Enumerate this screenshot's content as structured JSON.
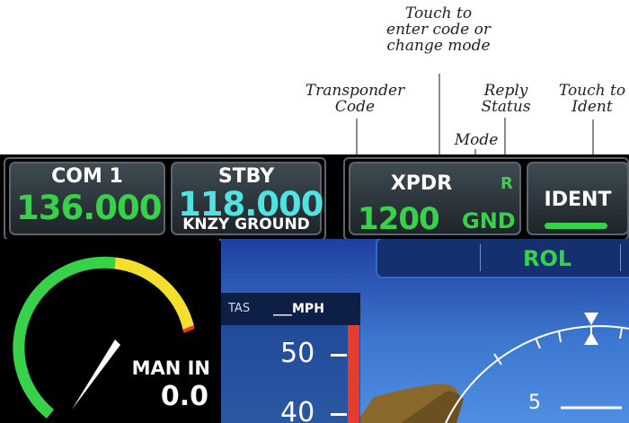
{
  "callouts": {
    "touch_code": "Touch to\nenter code or\nchange mode",
    "transponder_code": "Transponder\nCode",
    "reply_status": "Reply\nStatus",
    "touch_ident": "Touch to\nIdent",
    "mode": "Mode"
  },
  "com": {
    "title": "COM 1",
    "active_freq": "136.000",
    "standby_title": "STBY",
    "standby_freq": "118.000",
    "standby_station": "KNZY GROUND"
  },
  "xpdr": {
    "title": "XPDR",
    "reply": "R",
    "code": "1200",
    "mode": "GND"
  },
  "ident": {
    "label": "IDENT"
  },
  "gauge": {
    "label": "MAN IN",
    "value": "0.0"
  },
  "pfd": {
    "mode_annunciation": "ROL",
    "tas_label": "TAS",
    "tas_value": "___MPH",
    "speed_tape": [
      "50",
      "40"
    ],
    "pitch_mark": "5"
  },
  "colors": {
    "green": "#38d24a",
    "cyan": "#4fe3e3",
    "yellow": "#f2e02c",
    "red": "#e63b2e"
  }
}
